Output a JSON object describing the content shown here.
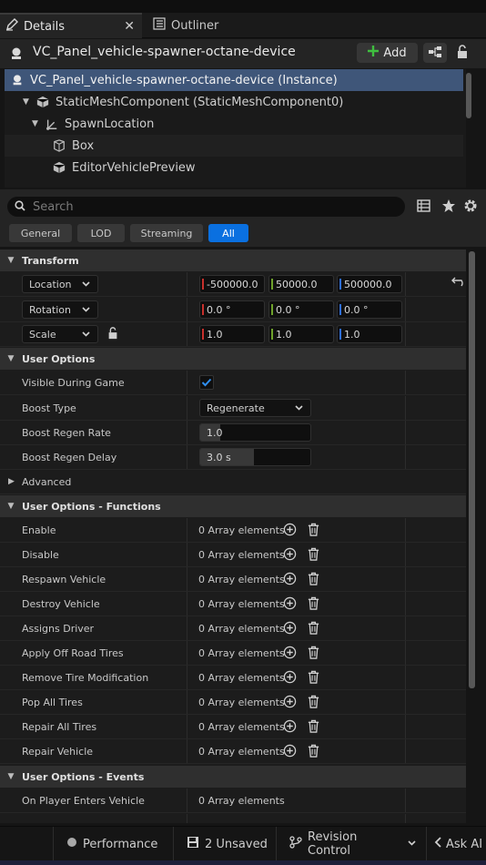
{
  "tabs": {
    "details": "Details",
    "outliner": "Outliner",
    "close_glyph": "✕"
  },
  "header": {
    "title": "VC_Panel_vehicle-spawner-octane-device",
    "add_label": "Add"
  },
  "tree": {
    "items": [
      {
        "label": "VC_Panel_vehicle-spawner-octane-device (Instance)",
        "icon": "actor-icon"
      },
      {
        "label": "StaticMeshComponent (StaticMeshComponent0)",
        "icon": "static-mesh-icon"
      },
      {
        "label": "SpawnLocation",
        "icon": "scene-component-icon"
      },
      {
        "label": "Box",
        "icon": "box-collision-icon"
      },
      {
        "label": "EditorVehiclePreview",
        "icon": "static-mesh-icon"
      }
    ]
  },
  "search": {
    "placeholder": "Search"
  },
  "filters": [
    "General",
    "LOD",
    "Streaming",
    "All"
  ],
  "transform": {
    "category": "Transform",
    "location": {
      "label": "Location",
      "x": "-500000.0",
      "y": "50000.0",
      "z": "500000.0"
    },
    "rotation": {
      "label": "Rotation",
      "x": "0.0 °",
      "y": "0.0 °",
      "z": "0.0 °"
    },
    "scale": {
      "label": "Scale",
      "x": "1.0",
      "y": "1.0",
      "z": "1.0"
    }
  },
  "user_options": {
    "category": "User Options",
    "visible_label": "Visible During Game",
    "visible_checked": true,
    "boost_type_label": "Boost Type",
    "boost_type_value": "Regenerate",
    "regen_rate_label": "Boost Regen Rate",
    "regen_rate_value": "1.0",
    "regen_rate_fraction": 0.18,
    "regen_delay_label": "Boost Regen Delay",
    "regen_delay_value": "3.0 s",
    "regen_delay_fraction": 0.49,
    "advanced_label": "Advanced"
  },
  "functions": {
    "category": "User Options - Functions",
    "array_text": "0 Array elements",
    "items": [
      "Enable",
      "Disable",
      "Respawn Vehicle",
      "Destroy Vehicle",
      "Assigns Driver",
      "Apply Off Road Tires",
      "Remove Tire Modification",
      "Pop All Tires",
      "Repair All Tires",
      "Repair Vehicle"
    ]
  },
  "events": {
    "category": "User Options - Events",
    "items": [
      {
        "label": "On Player Enters Vehicle",
        "value": "0 Array elements"
      }
    ]
  },
  "status": {
    "performance": "Performance",
    "unsaved": "2 Unsaved",
    "revision": "Revision Control",
    "ask_ai": "Ask AI"
  },
  "colors": {
    "accent": "#0a70e0",
    "selection": "#3f5679",
    "x_axis": "#c8302c",
    "y_axis": "#6ea22a",
    "z_axis": "#2f6fd8",
    "add_green": "#3fbf3f"
  }
}
